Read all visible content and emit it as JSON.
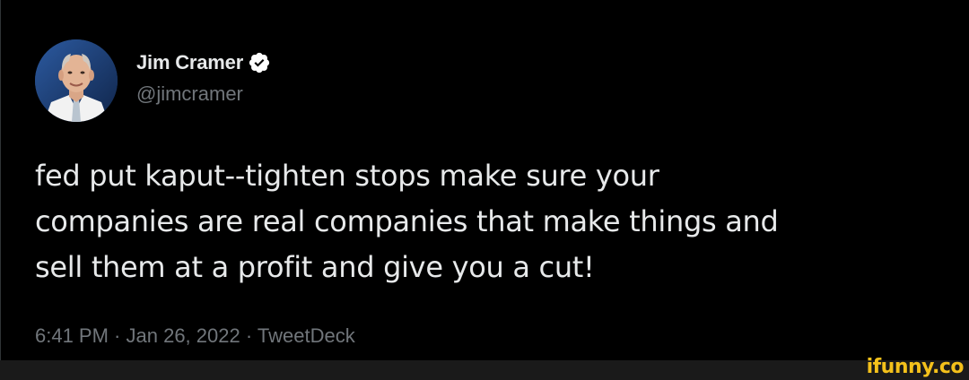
{
  "author": {
    "display_name": "Jim Cramer",
    "handle": "@jimcramer",
    "verified": true,
    "avatar_icon": "person-portrait"
  },
  "tweet": {
    "text": "fed put kaput--tighten stops make sure your\ncompanies are real companies that make things and\nsell them at a profit and give you a cut!"
  },
  "meta": {
    "time": "6:41 PM",
    "separator": " · ",
    "date": "Jan 26, 2022",
    "source": "TweetDeck"
  },
  "watermark": {
    "text": "ifunny.co"
  },
  "colors": {
    "background": "#000000",
    "primary_text": "#e7e9ea",
    "secondary_text": "#71767b",
    "verified_badge": "#ffffff",
    "watermark": "#f4c11b"
  }
}
